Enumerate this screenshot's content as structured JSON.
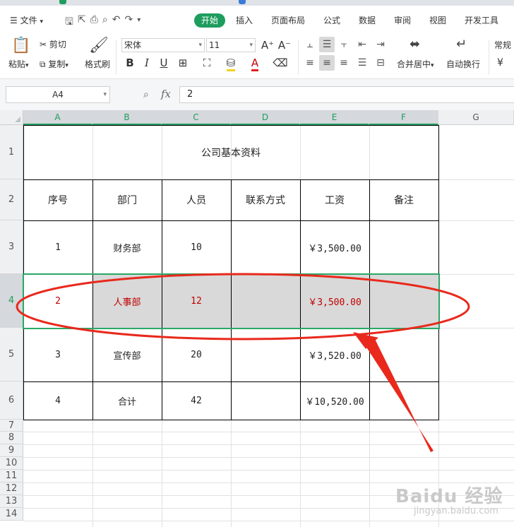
{
  "menu": {
    "file": "文件",
    "active_tab": "开始",
    "tabs": [
      "插入",
      "页面布局",
      "公式",
      "数据",
      "审阅",
      "视图",
      "开发工具"
    ]
  },
  "ribbon": {
    "paste": "粘贴",
    "cut": "剪切",
    "copy": "复制",
    "format_painter": "格式刷",
    "font_name": "宋体",
    "font_size": "11",
    "merge_center": "合并居中",
    "wrap_text": "自动换行",
    "number_format": "常规",
    "currency_symbol": "¥",
    "bold": "B",
    "italic": "I",
    "underline": "U",
    "font_grow": "A⁺",
    "font_shrink": "A⁻",
    "font_color_glyph": "A"
  },
  "formula_bar": {
    "name_box": "A4",
    "fx_label": "fx",
    "value": "2"
  },
  "sheet": {
    "columns": [
      "A",
      "B",
      "C",
      "D",
      "E",
      "F",
      "G"
    ],
    "selected_columns": [
      "A",
      "B",
      "C",
      "D",
      "E",
      "F"
    ],
    "rows": [
      "1",
      "2",
      "3",
      "4",
      "5",
      "6",
      "7",
      "8",
      "9",
      "10",
      "11",
      "12",
      "13",
      "14"
    ],
    "selected_row": "4",
    "title": "公司基本资料",
    "headers": [
      "序号",
      "部门",
      "人员",
      "联系方式",
      "工资",
      "备注"
    ],
    "data": [
      [
        "1",
        "财务部",
        "10",
        "",
        "￥3,500.00",
        ""
      ],
      [
        "2",
        "人事部",
        "12",
        "",
        "￥3,500.00",
        ""
      ],
      [
        "3",
        "宣传部",
        "20",
        "",
        "￥3,520.00",
        ""
      ],
      [
        "4",
        "合计",
        "42",
        "",
        "￥10,520.00",
        ""
      ]
    ]
  },
  "colors": {
    "accent_green": "#1f9d5e",
    "selection_border": "#2aa866",
    "highlight_text": "#c00000",
    "annotation_red": "#e8291c",
    "selection_fill": "#d9d9d9"
  },
  "watermark": {
    "brand": "Baidu 经验",
    "site": "jingyan.baidu.com"
  }
}
